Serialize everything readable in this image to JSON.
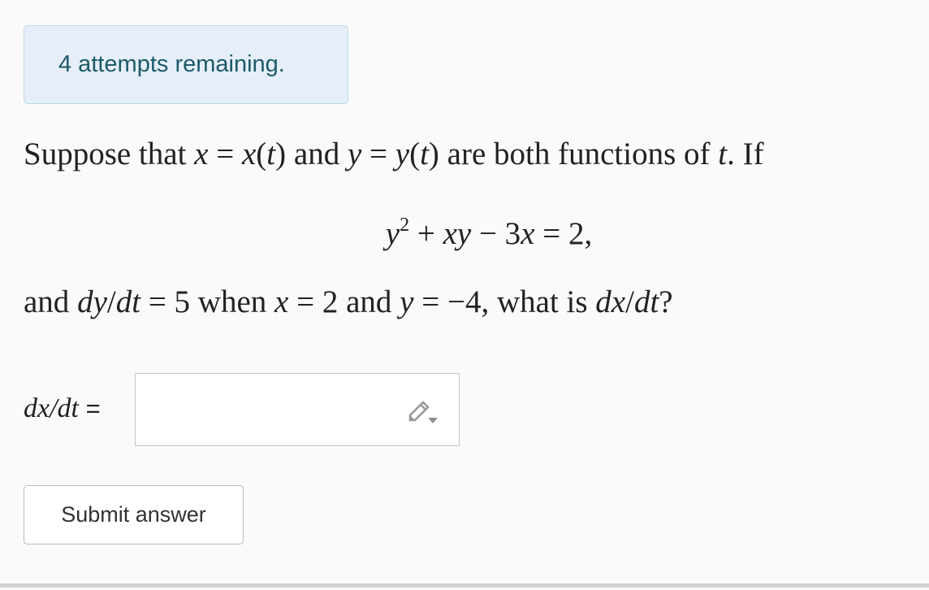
{
  "attempts": {
    "text": "4 attempts remaining."
  },
  "question": {
    "line1": {
      "t1": "Suppose that ",
      "m1": "x",
      "t2": " = ",
      "m2": "x",
      "t3": "(",
      "m3": "t",
      "t4": ") and ",
      "m4": "y",
      "t5": " = ",
      "m5": "y",
      "t6": "(",
      "m6": "t",
      "t7": ") are both functions of ",
      "m7": "t",
      "t8": ". If"
    },
    "equation": {
      "m1": "y",
      "sup": "2",
      "t1": " + ",
      "m2": "xy",
      "t2": " − 3",
      "m3": "x",
      "t3": " = 2,"
    },
    "line3": {
      "t1": "and ",
      "m1": "dy",
      "t2": "/",
      "m2": "dt",
      "t3": " = 5 when ",
      "m3": "x",
      "t4": " = 2 and ",
      "m4": "y",
      "t5": " = −4, what is ",
      "m5": "dx",
      "t6": "/",
      "m6": "dt",
      "t7": "?"
    }
  },
  "answer": {
    "label_var": "dx/dt",
    "label_eq": " =",
    "value": "",
    "icon": "pencil-icon"
  },
  "submit": {
    "label": "Submit answer"
  }
}
